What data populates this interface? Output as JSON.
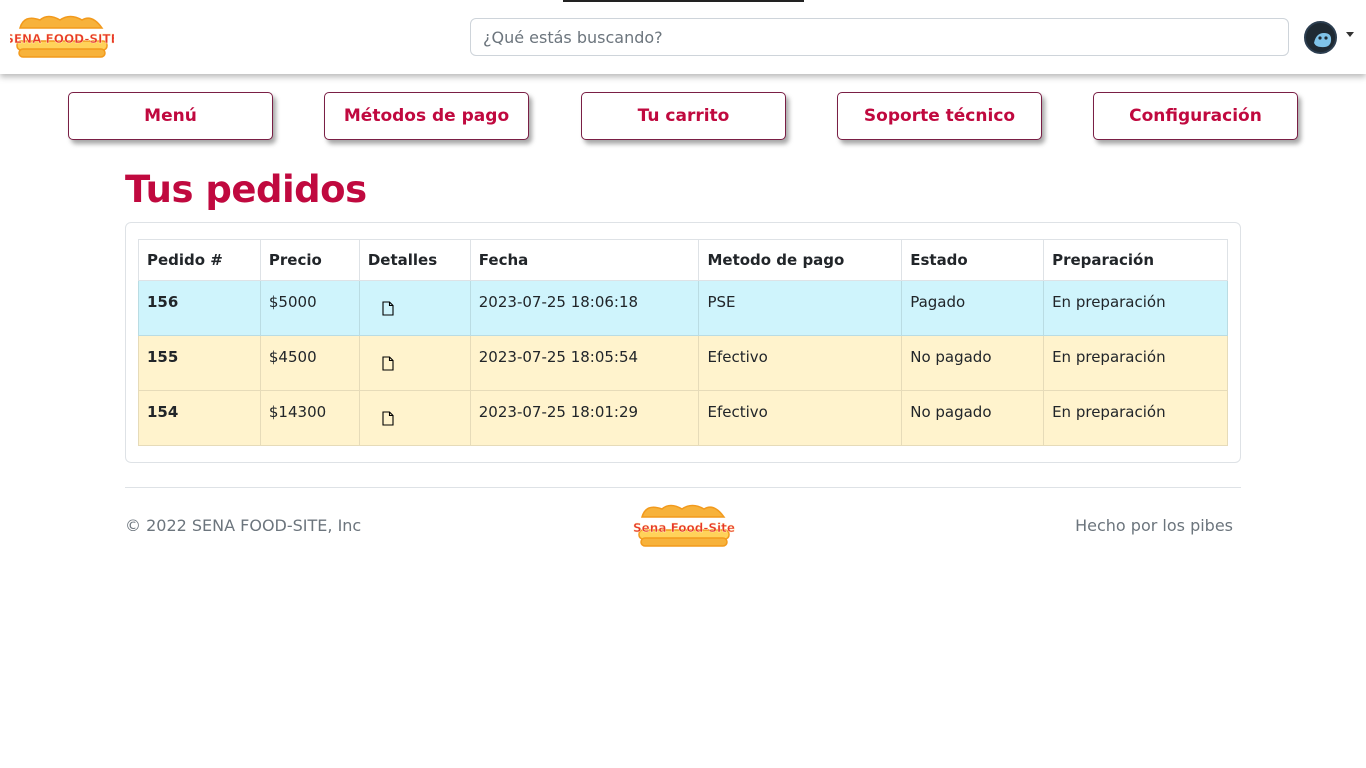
{
  "header": {
    "logo_text": "SENA FOOD-SITE",
    "search_placeholder": "¿Qué estás buscando?",
    "avatar": "user-avatar-icon"
  },
  "nav": {
    "items": [
      {
        "label": "Menú"
      },
      {
        "label": "Métodos de pago"
      },
      {
        "label": "Tu carrito"
      },
      {
        "label": "Soporte técnico"
      },
      {
        "label": "Configuración"
      }
    ]
  },
  "main": {
    "title": "Tus pedidos",
    "table": {
      "headers": [
        "Pedido #",
        "Precio",
        "Detalles",
        "Fecha",
        "Metodo de pago",
        "Estado",
        "Preparación"
      ],
      "rows": [
        {
          "id": "156",
          "price": "$5000",
          "details_icon": "document-icon",
          "date": "2023-07-25 18:06:18",
          "payment": "PSE",
          "status": "Pagado",
          "prep": "En preparación",
          "highlight": "info"
        },
        {
          "id": "155",
          "price": "$4500",
          "details_icon": "document-icon",
          "date": "2023-07-25 18:05:54",
          "payment": "Efectivo",
          "status": "No pagado",
          "prep": "En preparación",
          "highlight": "warning"
        },
        {
          "id": "154",
          "price": "$14300",
          "details_icon": "document-icon",
          "date": "2023-07-25 18:01:29",
          "payment": "Efectivo",
          "status": "No pagado",
          "prep": "En preparación",
          "highlight": "warning"
        }
      ]
    }
  },
  "footer": {
    "copyright": "© 2022 SENA FOOD-SITE, Inc",
    "logo_text": "Sena Food-Site",
    "credit": "Hecho por los pibes"
  },
  "colors": {
    "accent": "#c0093f",
    "row_info": "#cff4fc",
    "row_warning": "#fff3cd"
  }
}
